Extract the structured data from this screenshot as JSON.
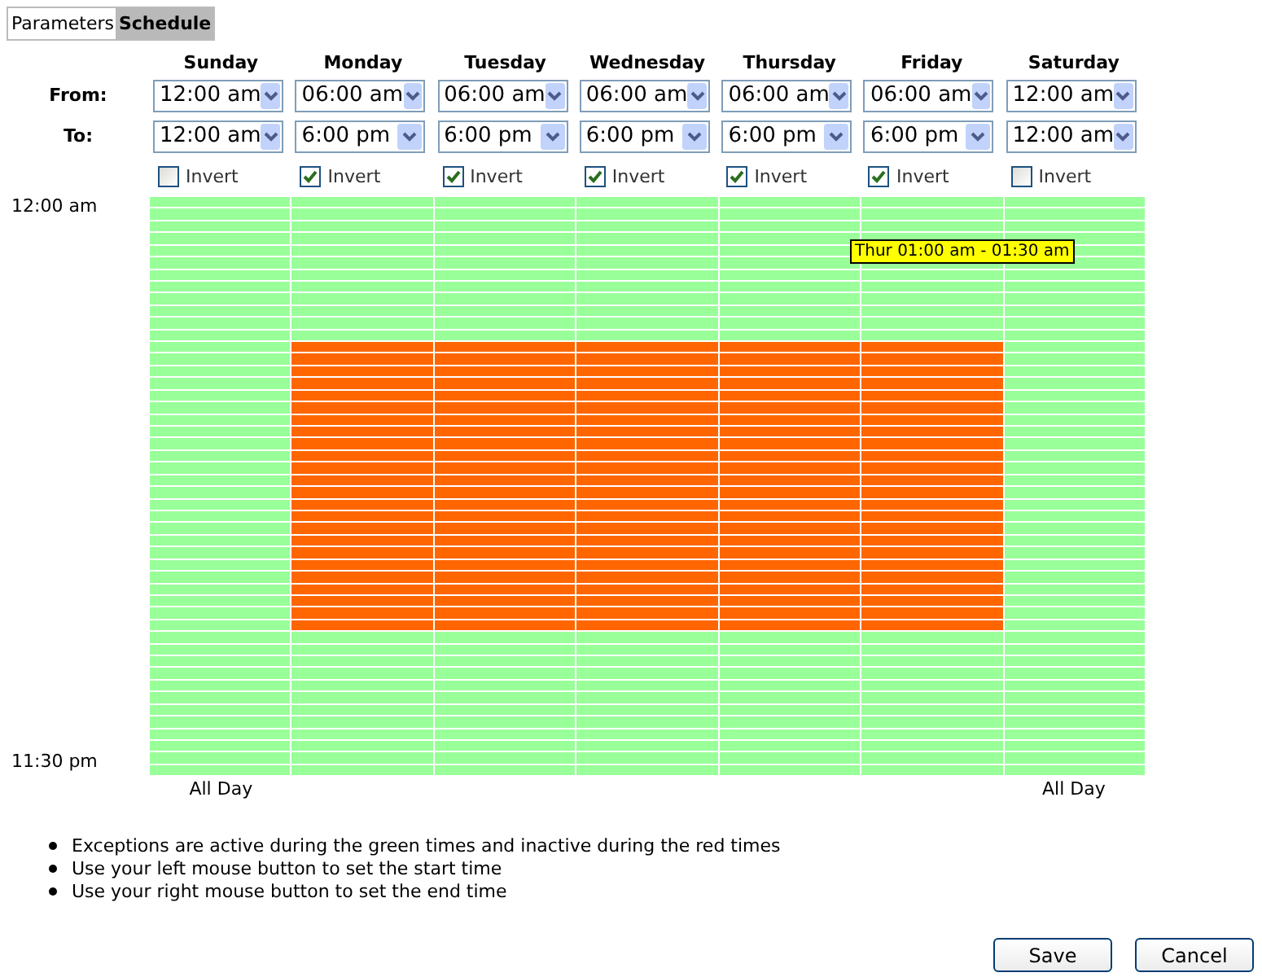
{
  "tabs": [
    {
      "label": "Parameters",
      "selected": false
    },
    {
      "label": "Schedule",
      "selected": true
    }
  ],
  "row_labels": {
    "from": "From:",
    "to": "To:"
  },
  "time_labels": {
    "start": "12:00 am",
    "end": "11:30 pm"
  },
  "days": [
    {
      "name": "Sunday",
      "from": "12:00 am",
      "to": "12:00 am",
      "invert_label": "Invert",
      "invert": false,
      "note": "All Day",
      "active_slots": [
        true,
        true,
        true,
        true,
        true,
        true,
        true,
        true,
        true,
        true,
        true,
        true,
        true,
        true,
        true,
        true,
        true,
        true,
        true,
        true,
        true,
        true,
        true,
        true,
        true,
        true,
        true,
        true,
        true,
        true,
        true,
        true,
        true,
        true,
        true,
        true,
        true,
        true,
        true,
        true,
        true,
        true,
        true,
        true,
        true,
        true,
        true,
        true
      ]
    },
    {
      "name": "Monday",
      "from": "06:00 am",
      "to": "6:00 pm",
      "invert_label": "Invert",
      "invert": true,
      "active_slots": [
        true,
        true,
        true,
        true,
        true,
        true,
        true,
        true,
        true,
        true,
        true,
        true,
        false,
        false,
        false,
        false,
        false,
        false,
        false,
        false,
        false,
        false,
        false,
        false,
        false,
        false,
        false,
        false,
        false,
        false,
        false,
        false,
        false,
        false,
        false,
        false,
        true,
        true,
        true,
        true,
        true,
        true,
        true,
        true,
        true,
        true,
        true,
        true
      ]
    },
    {
      "name": "Tuesday",
      "from": "06:00 am",
      "to": "6:00 pm",
      "invert_label": "Invert",
      "invert": true,
      "active_slots": [
        true,
        true,
        true,
        true,
        true,
        true,
        true,
        true,
        true,
        true,
        true,
        true,
        false,
        false,
        false,
        false,
        false,
        false,
        false,
        false,
        false,
        false,
        false,
        false,
        false,
        false,
        false,
        false,
        false,
        false,
        false,
        false,
        false,
        false,
        false,
        false,
        true,
        true,
        true,
        true,
        true,
        true,
        true,
        true,
        true,
        true,
        true,
        true
      ]
    },
    {
      "name": "Wednesday",
      "from": "06:00 am",
      "to": "6:00 pm",
      "invert_label": "Invert",
      "invert": true,
      "active_slots": [
        true,
        true,
        true,
        true,
        true,
        true,
        true,
        true,
        true,
        true,
        true,
        true,
        false,
        false,
        false,
        false,
        false,
        false,
        false,
        false,
        false,
        false,
        false,
        false,
        false,
        false,
        false,
        false,
        false,
        false,
        false,
        false,
        false,
        false,
        false,
        false,
        true,
        true,
        true,
        true,
        true,
        true,
        true,
        true,
        true,
        true,
        true,
        true
      ]
    },
    {
      "name": "Thursday",
      "from": "06:00 am",
      "to": "6:00 pm",
      "invert_label": "Invert",
      "invert": true,
      "active_slots": [
        true,
        true,
        true,
        true,
        true,
        true,
        true,
        true,
        true,
        true,
        true,
        true,
        false,
        false,
        false,
        false,
        false,
        false,
        false,
        false,
        false,
        false,
        false,
        false,
        false,
        false,
        false,
        false,
        false,
        false,
        false,
        false,
        false,
        false,
        false,
        false,
        true,
        true,
        true,
        true,
        true,
        true,
        true,
        true,
        true,
        true,
        true,
        true
      ]
    },
    {
      "name": "Friday",
      "from": "06:00 am",
      "to": "6:00 pm",
      "invert_label": "Invert",
      "invert": true,
      "active_slots": [
        true,
        true,
        true,
        true,
        true,
        true,
        true,
        true,
        true,
        true,
        true,
        true,
        false,
        false,
        false,
        false,
        false,
        false,
        false,
        false,
        false,
        false,
        false,
        false,
        false,
        false,
        false,
        false,
        false,
        false,
        false,
        false,
        false,
        false,
        false,
        false,
        true,
        true,
        true,
        true,
        true,
        true,
        true,
        true,
        true,
        true,
        true,
        true
      ]
    },
    {
      "name": "Saturday",
      "from": "12:00 am",
      "to": "12:00 am",
      "invert_label": "Invert",
      "invert": false,
      "note": "All Day",
      "active_slots": [
        true,
        true,
        true,
        true,
        true,
        true,
        true,
        true,
        true,
        true,
        true,
        true,
        true,
        true,
        true,
        true,
        true,
        true,
        true,
        true,
        true,
        true,
        true,
        true,
        true,
        true,
        true,
        true,
        true,
        true,
        true,
        true,
        true,
        true,
        true,
        true,
        true,
        true,
        true,
        true,
        true,
        true,
        true,
        true,
        true,
        true,
        true,
        true
      ]
    }
  ],
  "tooltip": "Thur 01:00 am - 01:30 am",
  "notes": [
    "Exceptions are active during the green times and inactive during the red times",
    "Use your left mouse button to set the start time",
    "Use your right mouse button to set the end time"
  ],
  "buttons": [
    "Save",
    "Cancel"
  ]
}
